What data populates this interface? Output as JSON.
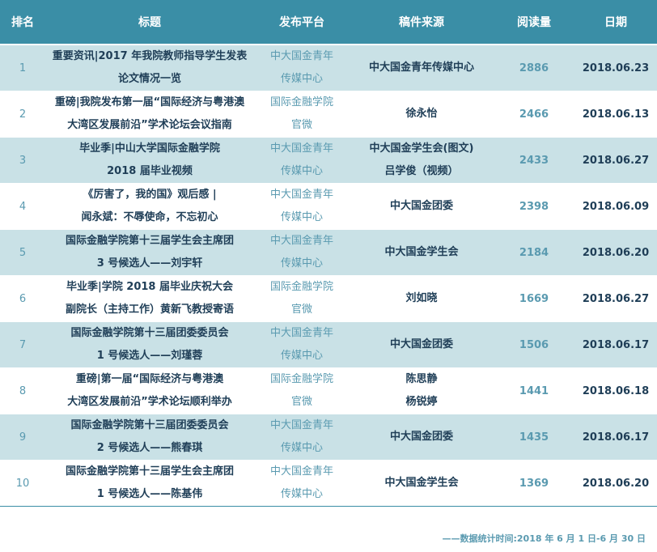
{
  "headers": {
    "rank": "排名",
    "title": "标题",
    "platform": "发布平台",
    "source": "稿件来源",
    "reads": "阅读量",
    "date": "日期"
  },
  "rows": [
    {
      "rank": "1",
      "title": [
        "重要资讯|2017 年我院教师指导学生发表",
        "论文情况一览"
      ],
      "platform": [
        "中大国金青年",
        "传媒中心"
      ],
      "source": [
        "中大国金青年传媒中心"
      ],
      "reads": "2886",
      "date": "2018.06.23"
    },
    {
      "rank": "2",
      "title": [
        "重磅|我院发布第一届“国际经济与粤港澳",
        "大湾区发展前沿”学术论坛会议指南"
      ],
      "platform": [
        "国际金融学院",
        "官微"
      ],
      "source": [
        "徐永怡"
      ],
      "reads": "2466",
      "date": "2018.06.13"
    },
    {
      "rank": "3",
      "title": [
        "毕业季|中山大学国际金融学院",
        "2018 届毕业视频"
      ],
      "platform": [
        "中大国金青年",
        "传媒中心"
      ],
      "source": [
        "中大国金学生会(图文)",
        "吕学俊（视频）"
      ],
      "reads": "2433",
      "date": "2018.06.27"
    },
    {
      "rank": "4",
      "title": [
        "《厉害了，我的国》观后感 |",
        "闻永斌：不辱使命，不忘初心"
      ],
      "platform": [
        "中大国金青年",
        "传媒中心"
      ],
      "source": [
        "中大国金团委"
      ],
      "reads": "2398",
      "date": "2018.06.09"
    },
    {
      "rank": "5",
      "title": [
        "国际金融学院第十三届学生会主席团",
        "3 号候选人——刘宇轩"
      ],
      "platform": [
        "中大国金青年",
        "传媒中心"
      ],
      "source": [
        "中大国金学生会"
      ],
      "reads": "2184",
      "date": "2018.06.20"
    },
    {
      "rank": "6",
      "title": [
        "毕业季|学院 2018 届毕业庆祝大会",
        "副院长（主持工作）黄新飞教授寄语"
      ],
      "platform": [
        "国际金融学院",
        "官微"
      ],
      "source": [
        "刘如晓"
      ],
      "reads": "1669",
      "date": "2018.06.27"
    },
    {
      "rank": "7",
      "title": [
        "国际金融学院第十三届团委委员会",
        "1 号候选人——刘瑾蓉"
      ],
      "platform": [
        "中大国金青年",
        "传媒中心"
      ],
      "source": [
        "中大国金团委"
      ],
      "reads": "1506",
      "date": "2018.06.17"
    },
    {
      "rank": "8",
      "title": [
        "重磅|第一届“国际经济与粤港澳",
        "大湾区发展前沿”学术论坛顺利举办"
      ],
      "platform": [
        "国际金融学院",
        "官微"
      ],
      "source": [
        "陈思静",
        "杨锐婷"
      ],
      "reads": "1441",
      "date": "2018.06.18"
    },
    {
      "rank": "9",
      "title": [
        "国际金融学院第十三届团委委员会",
        "2 号候选人——熊春琪"
      ],
      "platform": [
        "中大国金青年",
        "传媒中心"
      ],
      "source": [
        "中大国金团委"
      ],
      "reads": "1435",
      "date": "2018.06.17"
    },
    {
      "rank": "10",
      "title": [
        "国际金融学院第十三届学生会主席团",
        "1 号候选人——陈基伟"
      ],
      "platform": [
        "中大国金青年",
        "传媒中心"
      ],
      "source": [
        "中大国金学生会"
      ],
      "reads": "1369",
      "date": "2018.06.20"
    }
  ],
  "footer": "——数据统计时间:2018 年 6 月 1 日-6 月 30 日",
  "colors": {
    "header_bg": "#3a8ea6",
    "alt_row_bg": "#c9e1e6",
    "dark_text": "#1f3e57",
    "light_text": "#5a9ab0"
  }
}
